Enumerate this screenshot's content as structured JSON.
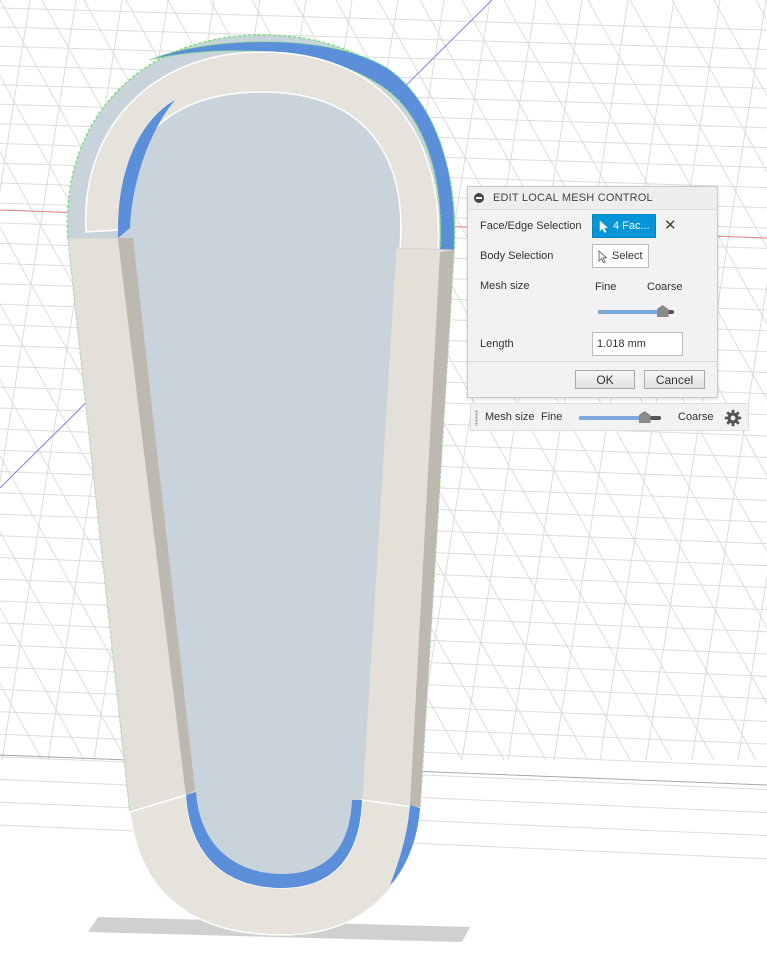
{
  "panel": {
    "title": "EDIT LOCAL MESH CONTROL",
    "face_edge_label": "Face/Edge Selection",
    "face_edge_value": "4 Fac...",
    "body_selection_label": "Body Selection",
    "body_selection_value": "Select",
    "mesh_size_label": "Mesh size",
    "fine_label": "Fine",
    "coarse_label": "Coarse",
    "mesh_size_level": 0.85,
    "length_label": "Length",
    "length_value": "1.018 mm",
    "ok_label": "OK",
    "cancel_label": "Cancel"
  },
  "mesh_bar": {
    "label": "Mesh size",
    "fine_label": "Fine",
    "coarse_label": "Coarse",
    "level": 0.8
  },
  "colors": {
    "accent": "#0696d7",
    "selected_face": "#5b8fd9",
    "part_face": "#e6e3dd",
    "part_side": "#c9d3dc",
    "selection_outline": "#7ee07a",
    "x_axis": "#e07070",
    "z_axis": "#7a7ae0",
    "grid": "#d9d9d9"
  },
  "icons": [
    "cursor-icon",
    "close-icon",
    "gear-icon",
    "collapse-icon"
  ]
}
